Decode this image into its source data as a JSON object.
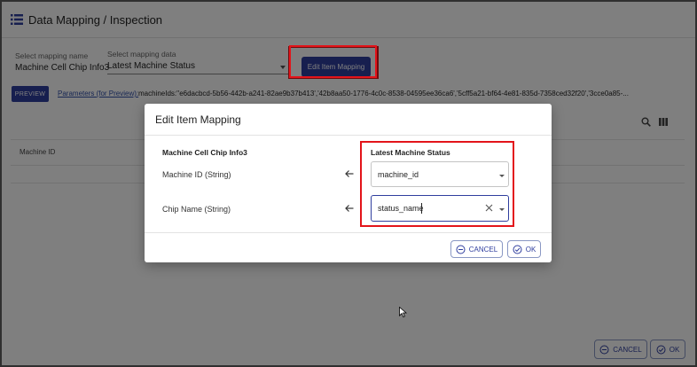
{
  "page": {
    "title": "Data Mapping / Inspection",
    "mapping_name_label": "Select mapping name",
    "mapping_name_value": "Machine Cell Chip Info3",
    "mapping_data_label": "Select mapping data",
    "mapping_data_value": "Latest Machine Status",
    "edit_mapping_button": "Edit Item Mapping",
    "preview_button": "PREVIEW",
    "parameters_link": "Parameters (for Preview):",
    "parameters_value": "machineIds:''e6dacbcd-5b56-442b-a241-82ae9b37b413','42b8aa50-1776-4c0c-8538-04595ee36ca6','5cff5a21-bf64-4e81-835d-7358ced32f20','3cce0a85-...",
    "table_columns": [
      "Machine ID"
    ],
    "cancel_button": "CANCEL",
    "ok_button": "OK"
  },
  "dialog": {
    "title": "Edit Item Mapping",
    "left_header": "Machine Cell Chip Info3",
    "right_header": "Latest Machine Status",
    "rows": [
      {
        "label": "Machine ID (String)",
        "value": "machine_id"
      },
      {
        "label": "Chip Name (String)",
        "value": "status_name"
      }
    ],
    "cancel_button": "CANCEL",
    "ok_button": "OK"
  },
  "colors": {
    "primary": "#2f3e9e",
    "highlight": "#e3141a"
  }
}
